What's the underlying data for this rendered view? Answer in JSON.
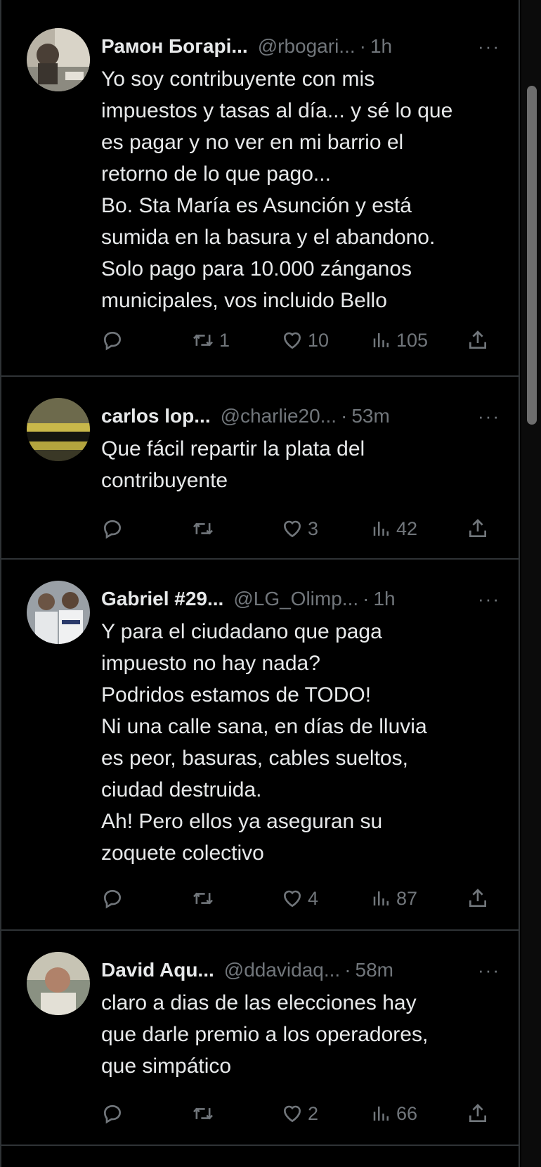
{
  "tweets": [
    {
      "name": "Рамон Богарі...",
      "handle": "@rbogari...",
      "sep": "·",
      "time": "1h",
      "more": "···",
      "text": "Yo soy contribuyente con mis\nimpuestos y tasas al día... y sé lo que\nes pagar y no ver en mi barrio el\nretorno de lo que pago...\nBo. Sta María es Asunción y está\nsumida en la basura y el abandono.\nSolo pago para 10.000 zánganos\nmunicipales, vos incluido Bello",
      "retweets": "1",
      "likes": "10",
      "views": "105"
    },
    {
      "name": "carlos lop...",
      "handle": "@charlie20...",
      "sep": "·",
      "time": "53m",
      "more": "···",
      "text": "Que fácil repartir la plata del\ncontribuyente",
      "retweets": "",
      "likes": "3",
      "views": "42"
    },
    {
      "name": "Gabriel #29...",
      "handle": "@LG_Olimp...",
      "sep": "·",
      "time": "1h",
      "more": "···",
      "text": "Y para el ciudadano que paga\nimpuesto no hay nada?\nPodridos estamos de TODO!\nNi una calle sana, en días de lluvia\nes peor, basuras, cables sueltos,\nciudad destruida.\nAh! Pero ellos ya aseguran su\nzoquete colectivo",
      "retweets": "",
      "likes": "4",
      "views": "87"
    },
    {
      "name": "David Aqu...",
      "handle": "@ddavidaq...",
      "sep": "·",
      "time": "58m",
      "more": "···",
      "text": "claro a dias de las elecciones hay\nque darle premio a los operadores,\nque simpático",
      "retweets": "",
      "likes": "2",
      "views": "66"
    }
  ],
  "icons": {
    "reply": "reply-icon",
    "retweet": "retweet-icon",
    "like": "heart-icon",
    "views": "views-icon",
    "share": "share-icon"
  },
  "colors": {
    "background": "#000000",
    "text": "#e7e9ea",
    "muted": "#71767b",
    "border": "#2f3336"
  }
}
